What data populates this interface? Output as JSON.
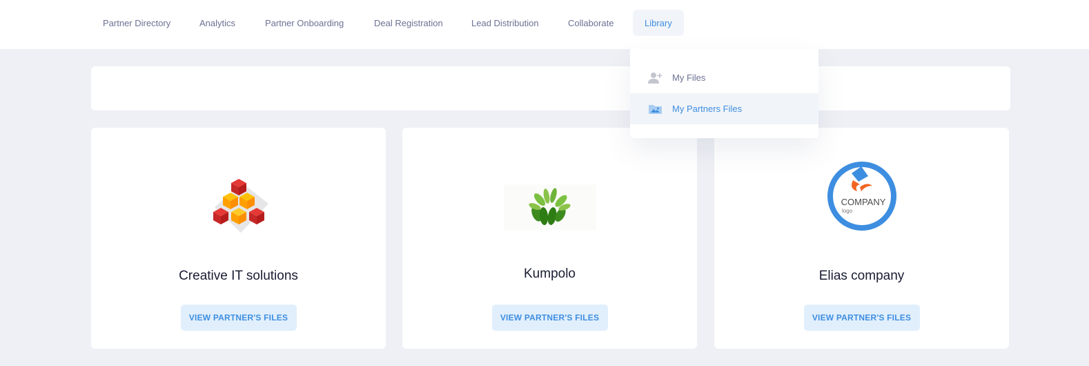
{
  "nav": {
    "items": [
      {
        "label": "Partner Directory",
        "active": false
      },
      {
        "label": "Analytics",
        "active": false
      },
      {
        "label": "Partner Onboarding",
        "active": false
      },
      {
        "label": "Deal Registration",
        "active": false
      },
      {
        "label": "Lead Distribution",
        "active": false
      },
      {
        "label": "Collaborate",
        "active": false
      },
      {
        "label": "Library",
        "active": true
      }
    ]
  },
  "library_menu": {
    "items": [
      {
        "label": "My Files",
        "icon": "add-user-icon",
        "active": false
      },
      {
        "label": "My Partners Files",
        "icon": "image-folder-icon",
        "active": true
      }
    ]
  },
  "partners": [
    {
      "name": "Creative IT solutions",
      "button_label": "VIEW PARTNER'S FILES",
      "logo": "red-yellow-cubes-logo"
    },
    {
      "name": "Kumpolo",
      "button_label": "VIEW PARTNER'S FILES",
      "logo": "green-leaves-logo"
    },
    {
      "name": "Elias company",
      "button_label": "VIEW PARTNER'S FILES",
      "logo": "company-circle-logo",
      "logo_text": "COMPANY",
      "logo_subtext": "logo"
    }
  ],
  "colors": {
    "accent": "#3e8ee0",
    "accent_light": "#e1effd",
    "page_bg": "#eef0f5"
  }
}
